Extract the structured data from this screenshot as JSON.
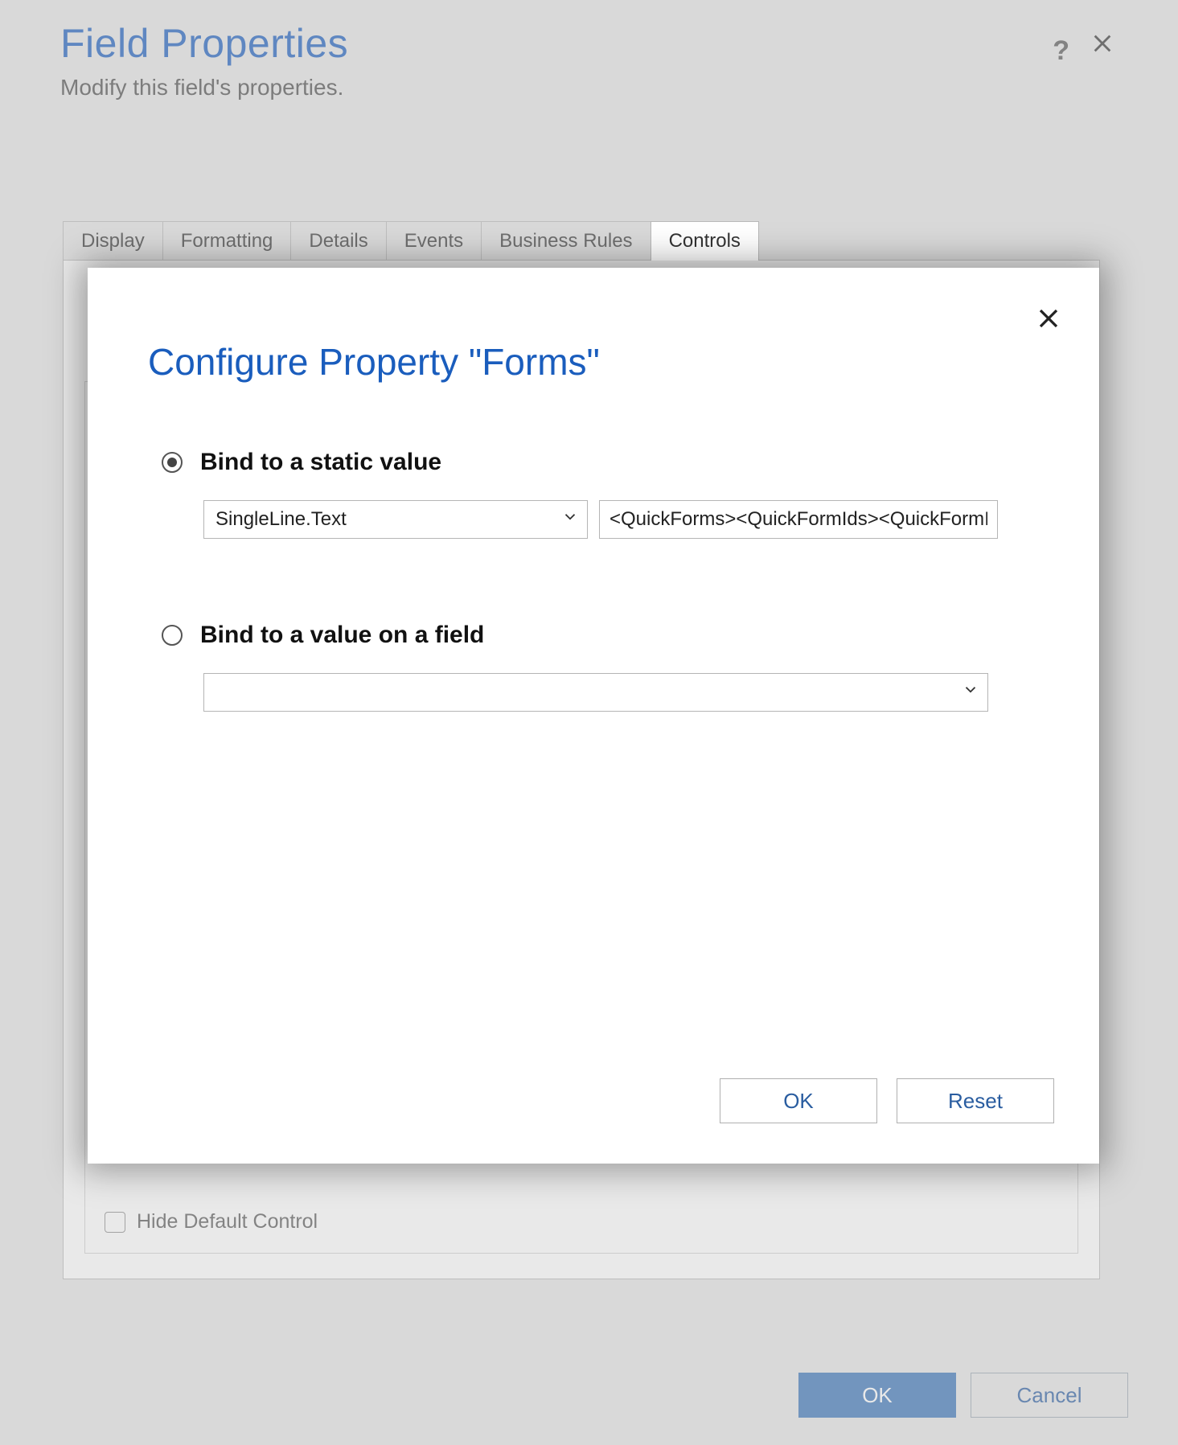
{
  "header": {
    "title": "Field Properties",
    "subtitle": "Modify this field's properties.",
    "help_tooltip": "?"
  },
  "tabs": [
    {
      "label": "Display"
    },
    {
      "label": "Formatting"
    },
    {
      "label": "Details"
    },
    {
      "label": "Events"
    },
    {
      "label": "Business Rules"
    },
    {
      "label": "Controls"
    }
  ],
  "options": {
    "hide_default_control": "Hide Default Control"
  },
  "footer": {
    "ok": "OK",
    "cancel": "Cancel"
  },
  "modal": {
    "title": "Configure Property \"Forms\"",
    "options": {
      "static": {
        "label": "Bind to a static value",
        "type_selected": "SingleLine.Text",
        "value": "<QuickForms><QuickFormIds><QuickFormId"
      },
      "field": {
        "label": "Bind to a value on a field",
        "selected": ""
      }
    },
    "buttons": {
      "ok": "OK",
      "reset": "Reset"
    }
  }
}
